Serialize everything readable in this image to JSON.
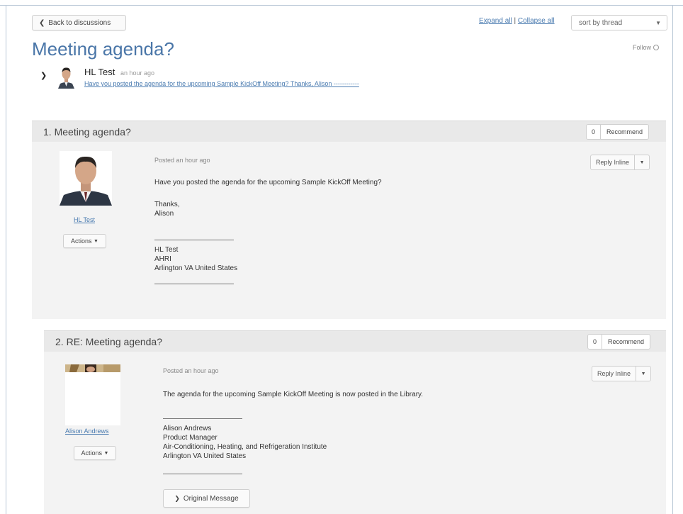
{
  "toolbar": {
    "back_label": "Back to discussions",
    "expand_all": "Expand all",
    "separator": "|",
    "collapse_all": "Collapse all",
    "sort_value": "sort by thread"
  },
  "thread": {
    "title": "Meeting agenda?",
    "follow_label": "Follow",
    "summary": {
      "author": "HL Test",
      "time": "an hour ago",
      "snippet": "Have you posted the agenda for the upcoming Sample KickOff Meeting? Thanks, Alison ------------"
    }
  },
  "posts": [
    {
      "number": "1.",
      "title": "Meeting agenda?",
      "recommend_count": "0",
      "recommend_label": "Recommend",
      "posted": "Posted an hour ago",
      "reply_label": "Reply Inline",
      "author_link": "HL Test",
      "actions_label": "Actions",
      "body": [
        "Have you posted the agenda for the upcoming Sample KickOff Meeting?",
        "Thanks,",
        "Alison"
      ],
      "signature": [
        "HL Test",
        "AHRI",
        "Arlington VA United States"
      ]
    },
    {
      "number": "2.",
      "title": "RE: Meeting agenda?",
      "recommend_count": "0",
      "recommend_label": "Recommend",
      "posted": "Posted an hour ago",
      "reply_label": "Reply Inline",
      "author_link": "Alison Andrews",
      "actions_label": "Actions",
      "body": [
        "The agenda for the upcoming Sample KickOff Meeting is now posted in the Library."
      ],
      "signature": [
        "Alison Andrews",
        "Product Manager",
        "Air-Conditioning, Heating, and Refrigeration Institute",
        "Arlington VA United States"
      ],
      "original_message_label": "Original Message"
    }
  ]
}
